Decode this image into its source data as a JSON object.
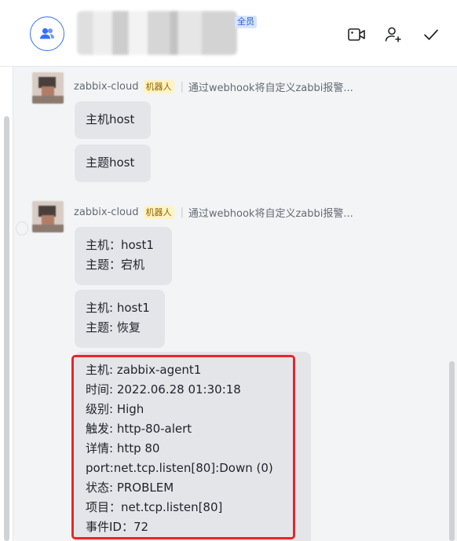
{
  "header": {
    "badge": "全员",
    "icons": [
      "group-icon",
      "video-icon",
      "add-member-icon",
      "check-icon"
    ]
  },
  "messages": [
    {
      "sender": "zabbix-cloud",
      "badge": "机器人",
      "source": "通过webhook将自定义zabbi报警...",
      "bubbles": [
        [
          "主机host"
        ],
        [
          "主题host"
        ]
      ]
    },
    {
      "sender": "zabbix-cloud",
      "badge": "机器人",
      "source": "通过webhook将自定义zabbi报警...",
      "bubbles": [
        [
          "主机：host1",
          "主题：宕机"
        ],
        [
          "主机: host1",
          "主题: 恢复"
        ],
        [
          "主机: zabbix-agent1",
          "时间: 2022.06.28 01:30:18",
          "级别: High",
          "触发: http-80-alert",
          "详情: http 80",
          "port:net.tcp.listen[80]:Down (0)",
          "状态: PROBLEM",
          "项目：net.tcp.listen[80]",
          "事件ID：72"
        ]
      ]
    }
  ],
  "colors": {
    "accent": "#3370ff",
    "highlight": "#e8252a",
    "bubble": "#e4e5e9"
  }
}
